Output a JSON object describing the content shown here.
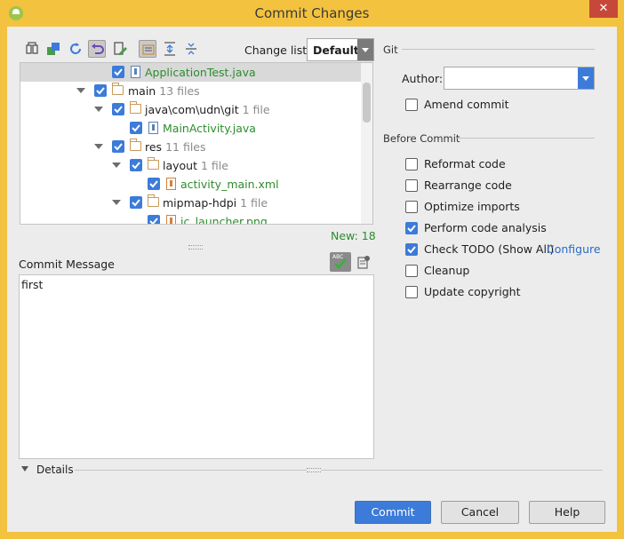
{
  "window": {
    "title": "Commit Changes",
    "close_glyph": "✕"
  },
  "toolbar": {
    "icons": [
      "diff-icon",
      "move-icon",
      "refresh-icon",
      "rollback-icon",
      "edit-source-icon",
      "group-by-directory-icon",
      "expand-all-icon",
      "collapse-all-icon"
    ]
  },
  "changelist": {
    "label": "Change list:",
    "value": "Default"
  },
  "tree": {
    "rows": [
      {
        "label": "ApplicationTest.java",
        "count": "",
        "type": "java"
      },
      {
        "label": "main",
        "count": "13 files",
        "type": "folder"
      },
      {
        "label": "java\\com\\udn\\git",
        "count": "1 file",
        "type": "folder"
      },
      {
        "label": "MainActivity.java",
        "count": "",
        "type": "java"
      },
      {
        "label": "res",
        "count": "11 files",
        "type": "folder"
      },
      {
        "label": "layout",
        "count": "1 file",
        "type": "folder"
      },
      {
        "label": "activity_main.xml",
        "count": "",
        "type": "xml"
      },
      {
        "label": "mipmap-hdpi",
        "count": "1 file",
        "type": "folder"
      },
      {
        "label": "ic_launcher.png",
        "count": "",
        "type": "png"
      }
    ]
  },
  "new_count": "New: 18",
  "commit_message": {
    "label": "Commit Message",
    "spell_badge": "ABC",
    "text": "first"
  },
  "details": {
    "label": "Details"
  },
  "git": {
    "title": "Git",
    "author_label": "Author:",
    "author_value": "",
    "amend_label": "Amend commit"
  },
  "before_commit": {
    "title": "Before Commit",
    "options": [
      {
        "label": "Reformat code",
        "checked": false
      },
      {
        "label": "Rearrange code",
        "checked": false
      },
      {
        "label": "Optimize imports",
        "checked": false
      },
      {
        "label": "Perform code analysis",
        "checked": true
      },
      {
        "label": "Check TODO (Show All)",
        "checked": true
      },
      {
        "label": "Cleanup",
        "checked": false
      },
      {
        "label": "Update copyright",
        "checked": false
      }
    ],
    "configure_link": "Configure"
  },
  "buttons": {
    "commit": "Commit",
    "cancel": "Cancel",
    "help": "Help"
  },
  "colors": {
    "accent": "#3c7bd9",
    "window_border": "#f3c23e",
    "green_text": "#2d8c2d",
    "link": "#2a6bc9",
    "close": "#c7483a"
  }
}
